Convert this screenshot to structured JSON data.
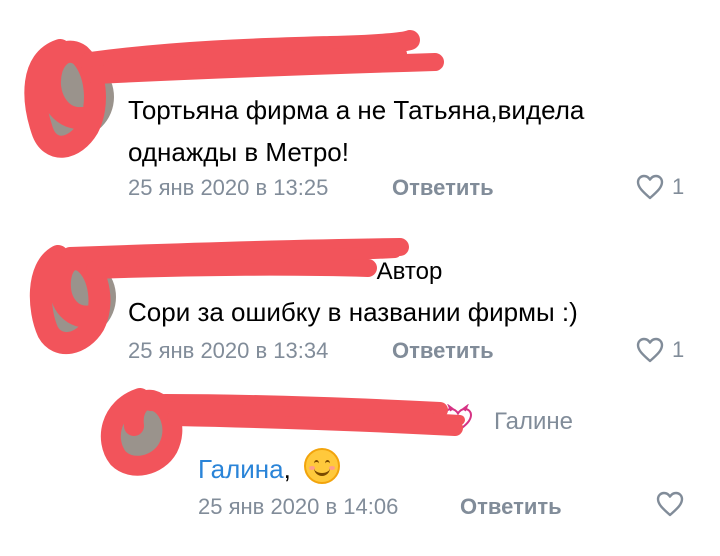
{
  "colors": {
    "text": "#000000",
    "meta": "#818c99",
    "link": "#2a84d8",
    "redaction": "#f2545b"
  },
  "comments": [
    {
      "text_line1": "Тортьяна фирма а не Татьяна,видела",
      "text_line2": "однажды в Метро!",
      "date": "25 янв 2020 в 13:25",
      "reply_label": "Ответить",
      "like_icon": "heart-outline-icon",
      "likes": "1"
    },
    {
      "badge": "· Автор",
      "text": "Сори за ошибку в названии фирмы :)",
      "date": "25 янв 2020 в 13:34",
      "reply_label": "Ответить",
      "like_icon": "heart-outline-icon",
      "likes": "1"
    },
    {
      "reply_to": "Галине",
      "mention": "Галина",
      "suffix": ",",
      "emoji": "smiling-face-emoji",
      "date": "25 янв 2020 в 14:06",
      "reply_label": "Ответить",
      "like_icon": "heart-outline-icon"
    }
  ]
}
